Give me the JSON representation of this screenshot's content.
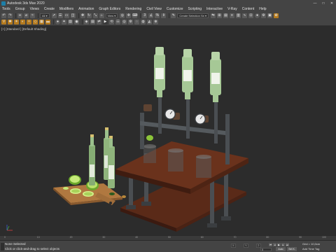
{
  "window": {
    "title": "Autodesk 3ds Max 2020"
  },
  "menu": [
    "Tools",
    "Group",
    "Views",
    "Create",
    "Modifiers",
    "Animation",
    "Graph Editors",
    "Rendering",
    "Civil View",
    "Customize",
    "Scripting",
    "Interactive",
    "V-Ray",
    "Content",
    "Help"
  ],
  "toolbar1": {
    "selection_filter": "All",
    "view_dropdown": "View",
    "named_selection": "Create Selection Se"
  },
  "viewport": {
    "label": "[+] [Standard ] [Default Shading]"
  },
  "timeline": {
    "ticks": [
      "0",
      "10",
      "20",
      "30",
      "40",
      "50",
      "60",
      "70",
      "80",
      "90",
      "100"
    ]
  },
  "status": {
    "line1": "None Selected",
    "line2": "Click or click-and-drag to select objects",
    "coord_x": "X:",
    "coord_y": "Y:",
    "coord_z": "Z:",
    "grid": "Grid = 10,0cm",
    "add_time_tag": "Add Time Tag",
    "frame": "0",
    "autokey": "Auto",
    "setkey": "Set K."
  },
  "colors": {
    "ui_bg": "#444444",
    "viewport_bg": "#2c2c2c",
    "wood": "#5a2a18",
    "pipe": "#4a4e52",
    "bottle": "#9bc08c",
    "lime": "#9fd24a"
  }
}
